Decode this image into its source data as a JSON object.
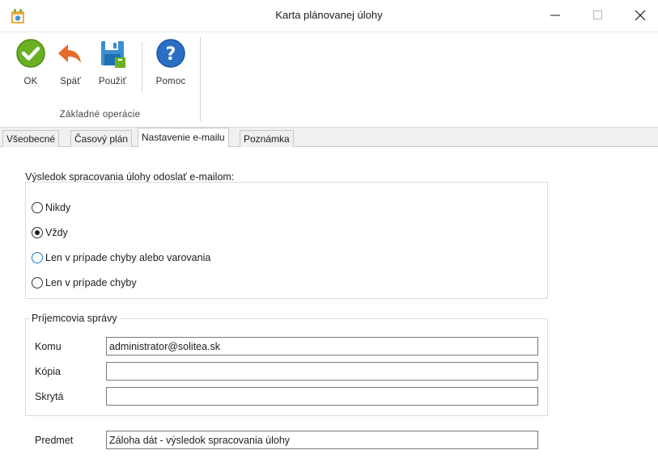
{
  "window": {
    "title": "Karta plánovanej úlohy",
    "minimize_label": "—",
    "maximize_label": "☐",
    "close_label": "✕"
  },
  "ribbon": {
    "buttons": [
      {
        "label": "OK",
        "icon": "check-circle-icon",
        "color": "#6ab023"
      },
      {
        "label": "Späť",
        "icon": "undo-arrow-icon",
        "color": "#e8692a"
      },
      {
        "label": "Použiť",
        "icon": "save-disk-icon",
        "color": "#3b8ed0"
      },
      {
        "label": "Pomoc",
        "icon": "help-icon",
        "color": "#2b6fc4"
      }
    ],
    "group_label": "Základné operácie"
  },
  "tabs": [
    {
      "label": "Všeobecné",
      "active": false
    },
    {
      "label": "Časový plán",
      "active": false
    },
    {
      "label": "Nastavenie e-mailu",
      "active": true
    },
    {
      "label": "Poznámka",
      "active": false
    }
  ],
  "email_settings": {
    "heading": "Výsledok spracovania úlohy odoslať e-mailom:",
    "options": [
      {
        "label": "Nikdy",
        "checked": false
      },
      {
        "label": "Vždy",
        "checked": true
      },
      {
        "label": "Len v prípade chyby alebo varovania",
        "checked": false
      },
      {
        "label": "Len v prípade chyby",
        "checked": false
      }
    ],
    "recipients": {
      "legend": "Príjemcovia správy",
      "to_label": "Komu",
      "to_value": "administrator@solitea.sk",
      "cc_label": "Kópia",
      "cc_value": "",
      "bcc_label": "Skrytá",
      "bcc_value": ""
    },
    "subject_label": "Predmet",
    "subject_value": "Záloha dát - výsledok spracovania úlohy"
  }
}
